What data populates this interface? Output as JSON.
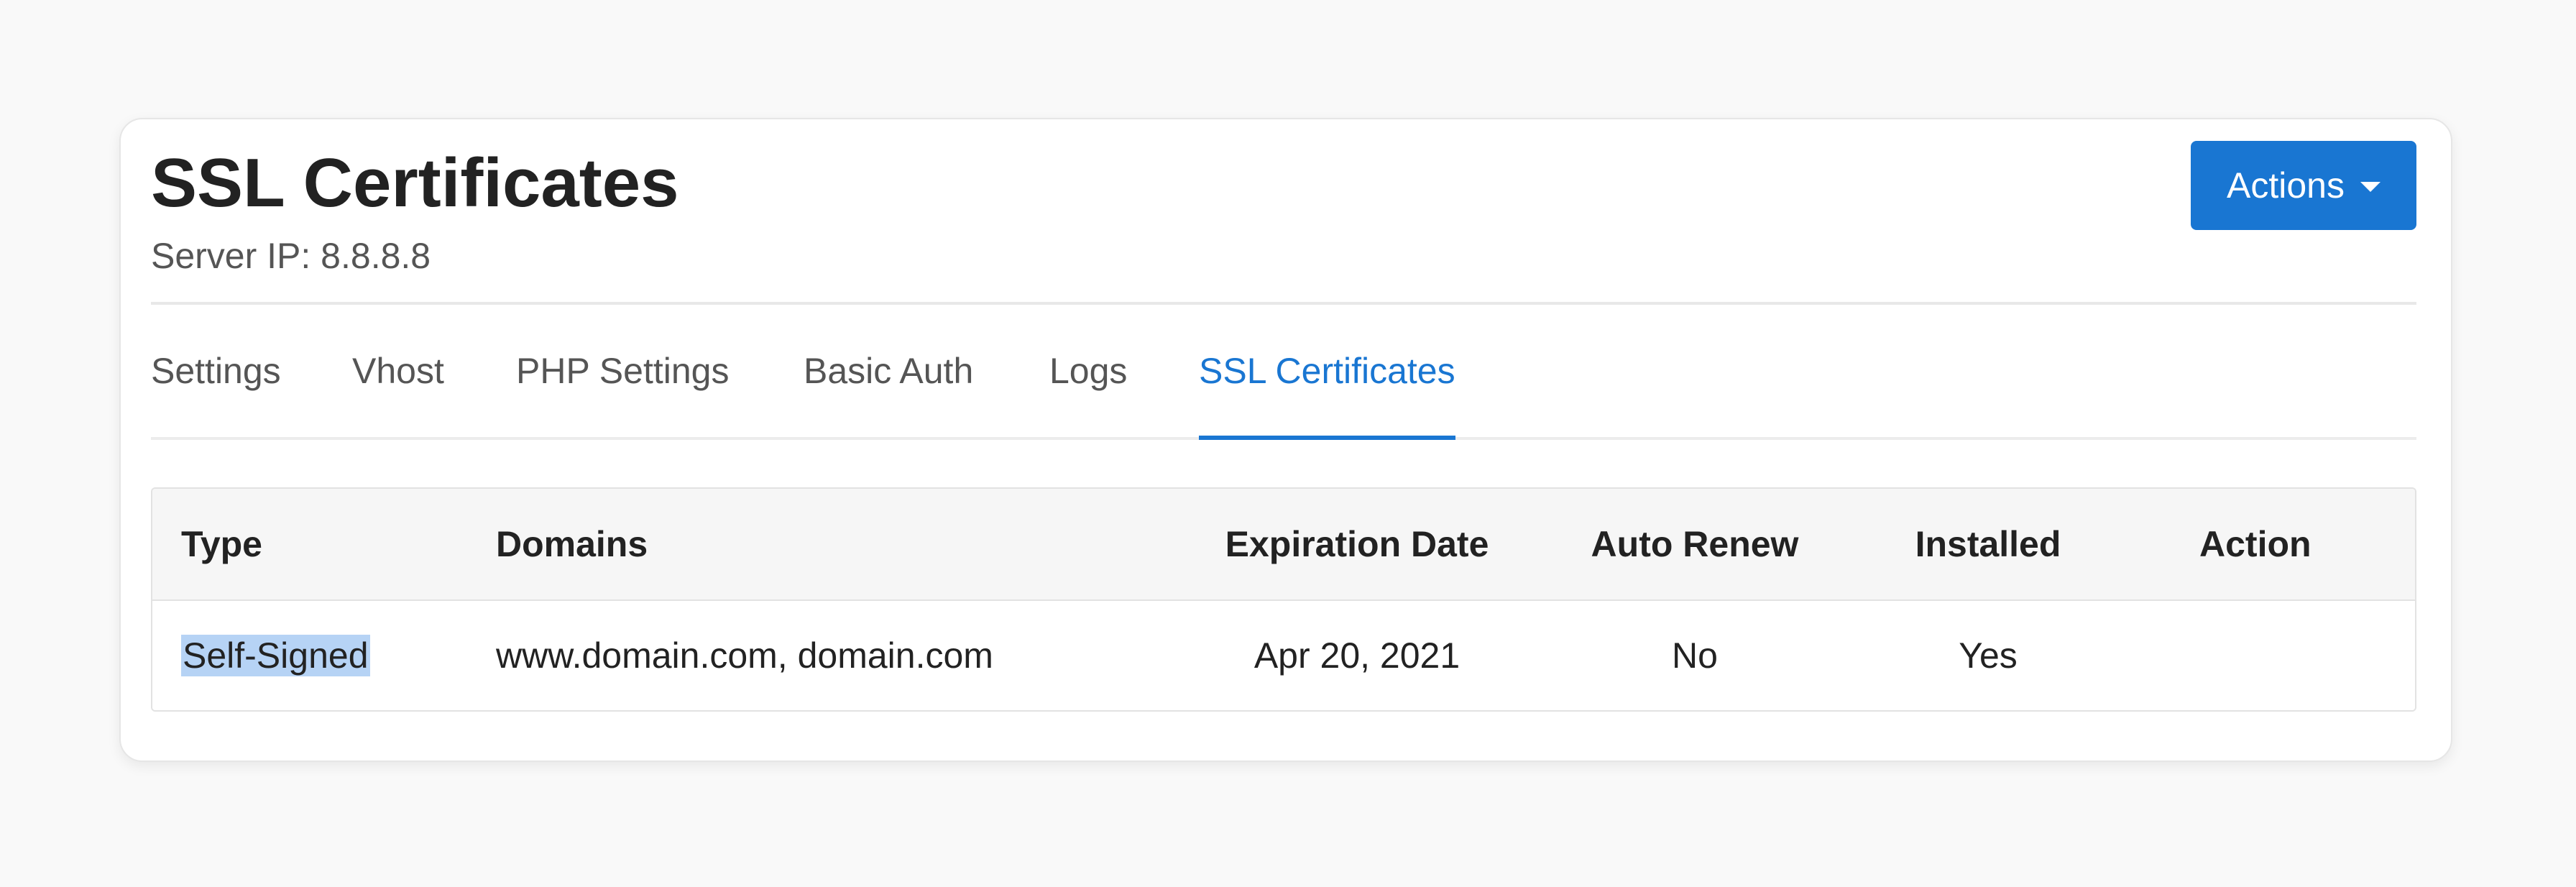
{
  "page": {
    "title": "SSL Certificates",
    "subtitle": "Server IP: 8.8.8.8"
  },
  "header": {
    "actions_label": "Actions"
  },
  "tabs": [
    {
      "label": "Settings",
      "active": false
    },
    {
      "label": "Vhost",
      "active": false
    },
    {
      "label": "PHP Settings",
      "active": false
    },
    {
      "label": "Basic Auth",
      "active": false
    },
    {
      "label": "Logs",
      "active": false
    },
    {
      "label": "SSL Certificates",
      "active": true
    }
  ],
  "table": {
    "columns": [
      "Type",
      "Domains",
      "Expiration Date",
      "Auto Renew",
      "Installed",
      "Action"
    ],
    "rows": [
      {
        "type": "Self-Signed",
        "domains": "www.domain.com, domain.com",
        "expiration_date": "Apr 20, 2021",
        "auto_renew": "No",
        "installed": "Yes",
        "action": ""
      }
    ]
  },
  "colors": {
    "accent": "#1976d2",
    "selection": "#b6d3f5",
    "background": "#f9f9f9"
  },
  "icons": {
    "actions_caret": "caret-down-icon"
  }
}
